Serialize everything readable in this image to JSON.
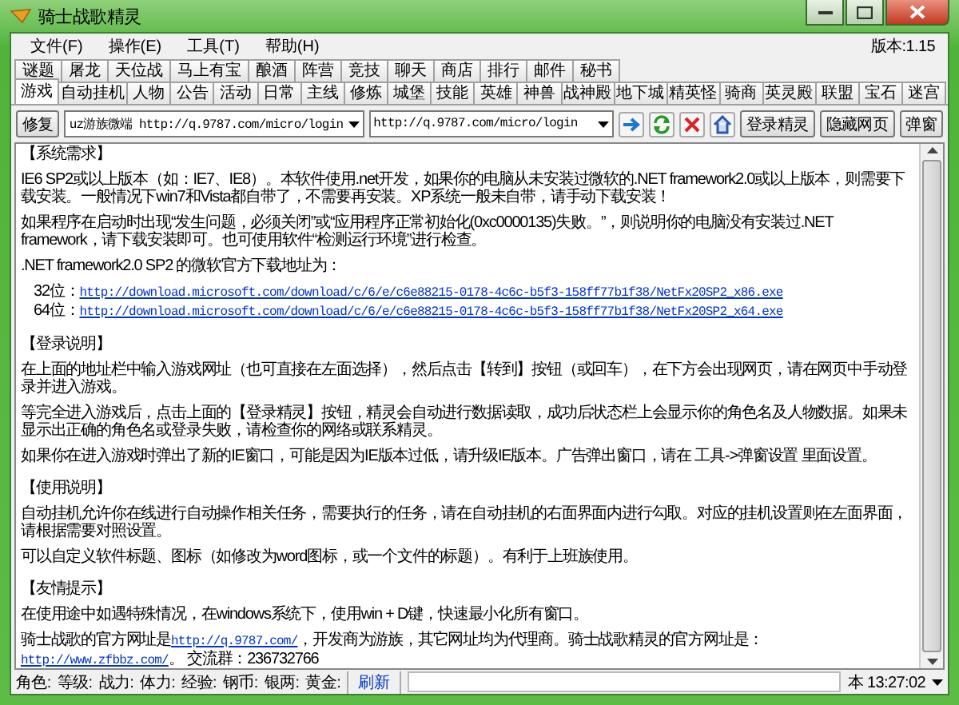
{
  "window": {
    "title": "骑士战歌精灵"
  },
  "menu": [
    "文件(F)",
    "操作(E)",
    "工具(T)",
    "帮助(H)"
  ],
  "version": "版本:1.15",
  "tabs_row1": [
    {
      "label": "谜题",
      "selected": false
    },
    {
      "label": "屠龙",
      "selected": false
    },
    {
      "label": "天位战",
      "selected": false
    },
    {
      "label": "马上有宝",
      "selected": false
    },
    {
      "label": "酿酒",
      "selected": false
    },
    {
      "label": "阵营",
      "selected": false
    },
    {
      "label": "竞技",
      "selected": false
    },
    {
      "label": "聊天",
      "selected": false
    },
    {
      "label": "商店",
      "selected": false
    },
    {
      "label": "排行",
      "selected": false
    },
    {
      "label": "邮件",
      "selected": false
    },
    {
      "label": "秘书",
      "selected": false
    }
  ],
  "tabs_row2": [
    {
      "label": "游戏",
      "selected": true
    },
    {
      "label": "自动挂机",
      "selected": false
    },
    {
      "label": "人物",
      "selected": false
    },
    {
      "label": "公告",
      "selected": false
    },
    {
      "label": "活动",
      "selected": false
    },
    {
      "label": "日常",
      "selected": false
    },
    {
      "label": "主线",
      "selected": false
    },
    {
      "label": "修炼",
      "selected": false
    },
    {
      "label": "城堡",
      "selected": false
    },
    {
      "label": "技能",
      "selected": false
    },
    {
      "label": "英雄",
      "selected": false
    },
    {
      "label": "神兽",
      "selected": false
    },
    {
      "label": "战神殿",
      "selected": false
    },
    {
      "label": "地下城",
      "selected": false
    },
    {
      "label": "精英怪",
      "selected": false
    },
    {
      "label": "骑商",
      "selected": false
    },
    {
      "label": "英灵殿",
      "selected": false
    },
    {
      "label": "联盟",
      "selected": false
    },
    {
      "label": "宝石",
      "selected": false
    },
    {
      "label": "迷宫",
      "selected": false
    }
  ],
  "toolbar": {
    "repair_button": "修复",
    "server_select": "uz游族微端  http://q.9787.com/micro/login",
    "address": "http://q.9787.com/micro/login",
    "buttons": [
      "登录精灵",
      "隐藏网页",
      "弹窗"
    ]
  },
  "content": [
    {
      "kind": "heading",
      "text": "【系统需求】"
    },
    {
      "kind": "para",
      "segments": [
        {
          "kind": "text",
          "text": "IE6 SP2或以上版本（如：IE7、IE8）。本软件使用.net开发，如果你的电脑从未安装过微软的.NET framework2.0或以上版本，则需要下载安装。一般情况下win7和Vista都自带了，不需要再安装。XP系统一般未自带，请手动下载安装！"
        }
      ]
    },
    {
      "kind": "para",
      "segments": [
        {
          "kind": "text",
          "text": "如果程序在启动时出现“发生问题，必须关闭”或“应用程序正常初始化(0xc0000135)失败。”，则说明你的电脑没有安装过.NET framework，请下载安装即可。也可使用软件“检测运行环境”进行检查。"
        }
      ]
    },
    {
      "kind": "para",
      "segments": [
        {
          "kind": "text",
          "text": ".NET framework2.0 SP2 的微软官方下载地址为："
        }
      ]
    },
    {
      "kind": "line",
      "segments": [
        {
          "kind": "text",
          "text": "32位："
        },
        {
          "kind": "link",
          "text": "http://download.microsoft.com/download/c/6/e/c6e88215-0178-4c6c-b5f3-158ff77b1f38/NetFx20SP2_x86.exe"
        }
      ]
    },
    {
      "kind": "line",
      "segments": [
        {
          "kind": "text",
          "text": "64位："
        },
        {
          "kind": "link",
          "text": "http://download.microsoft.com/download/c/6/e/c6e88215-0178-4c6c-b5f3-158ff77b1f38/NetFx20SP2_x64.exe"
        }
      ]
    },
    {
      "kind": "heading",
      "text": "【登录说明】"
    },
    {
      "kind": "para",
      "segments": [
        {
          "kind": "text",
          "text": "在上面的地址栏中输入游戏网址（也可直接在左面选择），然后点击【转到】按钮（或回车），在下方会出现网页，请在网页中手动登录并进入游戏。"
        }
      ]
    },
    {
      "kind": "para",
      "segments": [
        {
          "kind": "text",
          "text": "等完全进入游戏后，点击上面的【登录精灵】按钮，精灵会自动进行数据读取，成功后状态栏上会显示你的角色名及人物数据。如果未显示出正确的角色名或登录失败，请检查你的网络或联系精灵。"
        }
      ]
    },
    {
      "kind": "para",
      "segments": [
        {
          "kind": "text",
          "text": "如果你在进入游戏时弹出了新的IE窗口，可能是因为IE版本过低，请升级IE版本。广告弹出窗口，请在 工具->弹窗设置 里面设置。"
        }
      ]
    },
    {
      "kind": "heading",
      "text": "【使用说明】"
    },
    {
      "kind": "para",
      "segments": [
        {
          "kind": "text",
          "text": "自动挂机允许你在线进行自动操作相关任务，需要执行的任务，请在自动挂机的右面界面内进行勾取。对应的挂机设置则在左面界面，请根据需要对照设置。"
        }
      ]
    },
    {
      "kind": "para",
      "segments": [
        {
          "kind": "text",
          "text": "可以自定义软件标题、图标（如修改为word图标，或一个文件的标题）。有利于上班族使用。"
        }
      ]
    },
    {
      "kind": "heading",
      "text": "【友情提示】"
    },
    {
      "kind": "para",
      "segments": [
        {
          "kind": "text",
          "text": "在使用途中如遇特殊情况，在windows系统下，使用win + D键，快速最小化所有窗口。"
        }
      ]
    },
    {
      "kind": "para",
      "segments": [
        {
          "kind": "text",
          "text": "骑士战歌的官方网址是"
        },
        {
          "kind": "link",
          "text": "http://q.9787.com/"
        },
        {
          "kind": "text",
          "text": "，开发商为游族，其它网址均为代理商。骑士战歌精灵的官方网址是："
        },
        {
          "kind": "link",
          "text": "http://www.zfbbz.com/"
        },
        {
          "kind": "text",
          "text": "。 交流群：236732766"
        }
      ]
    }
  ],
  "status_bar": {
    "fields": [
      "角色:",
      "等级:",
      "战力:",
      "体力:",
      "经验:",
      "钢币:",
      "银两:",
      "黄金:"
    ],
    "refresh": "刷新",
    "time": "本 13:27:02"
  }
}
